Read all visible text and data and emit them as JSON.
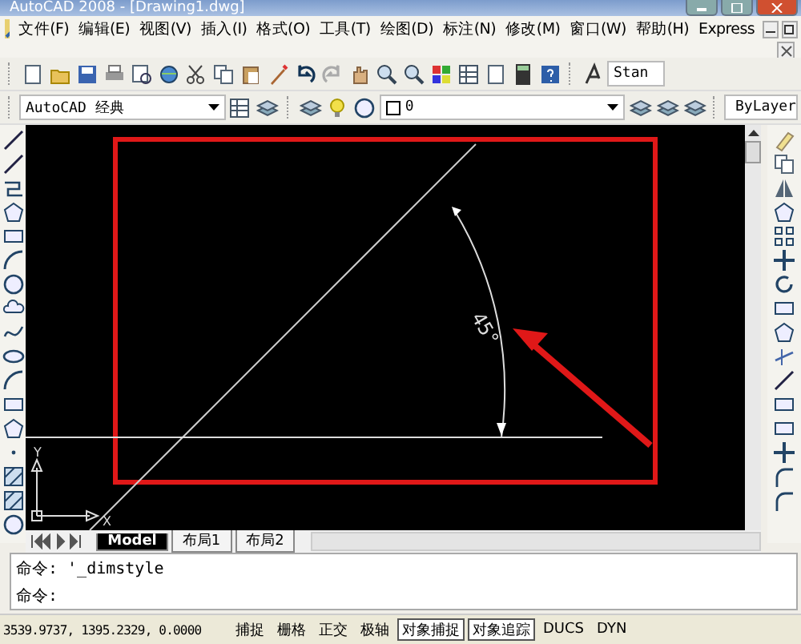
{
  "window": {
    "title": "AutoCAD 2008 - [Drawing1.dwg]"
  },
  "menu": [
    {
      "label": "文件(F)"
    },
    {
      "label": "编辑(E)"
    },
    {
      "label": "视图(V)"
    },
    {
      "label": "插入(I)"
    },
    {
      "label": "格式(O)"
    },
    {
      "label": "工具(T)"
    },
    {
      "label": "绘图(D)"
    },
    {
      "label": "标注(N)"
    },
    {
      "label": "修改(M)"
    },
    {
      "label": "窗口(W)"
    },
    {
      "label": "帮助(H)"
    },
    {
      "label": "Express"
    }
  ],
  "toolbar": {
    "style_combo": "Stan"
  },
  "workspace_combo": {
    "value": "AutoCAD 经典"
  },
  "layer_combo": {
    "value": "0"
  },
  "color_combo": {
    "value": "ByLayer"
  },
  "canvas": {
    "dimension_text": "45°",
    "ucs_y": "Y",
    "ucs_x": "X"
  },
  "layout_tabs": [
    {
      "label": "Model",
      "selected": true
    },
    {
      "label": "布局1",
      "selected": false
    },
    {
      "label": "布局2",
      "selected": false
    }
  ],
  "command_lines": [
    "命令: '_dimstyle",
    "命令:"
  ],
  "status_bar": {
    "coordinates": "3539.9737, 1395.2329, 0.0000",
    "toggles": [
      {
        "label": "捕捉",
        "on": false
      },
      {
        "label": "栅格",
        "on": false
      },
      {
        "label": "正交",
        "on": false
      },
      {
        "label": "极轴",
        "on": false
      },
      {
        "label": "对象捕捉",
        "on": true
      },
      {
        "label": "对象追踪",
        "on": true
      },
      {
        "label": "DUCS",
        "on": false
      },
      {
        "label": "DYN",
        "on": false
      }
    ]
  }
}
